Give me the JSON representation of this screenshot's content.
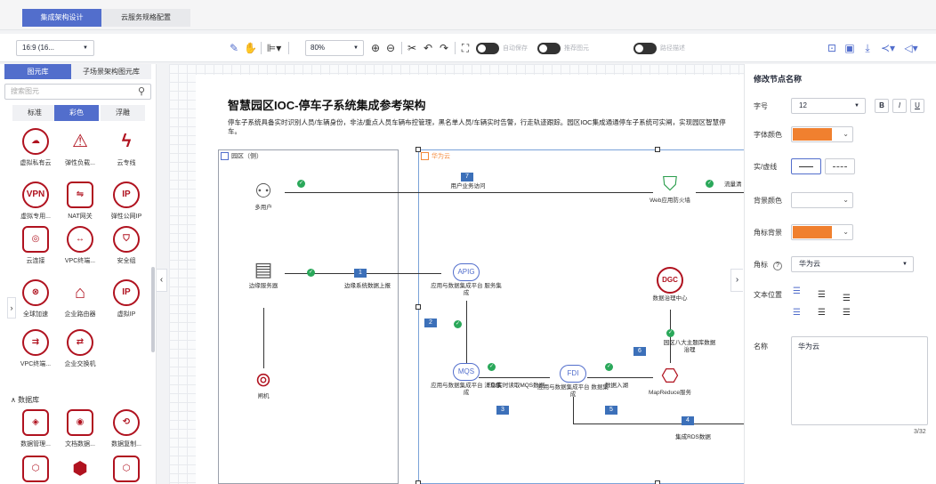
{
  "tabs": {
    "active": "集成架构设计",
    "inactive": "云服务规格配置"
  },
  "toolbar": {
    "ratio": "16:9 (16...",
    "zoom": "80%",
    "toggle_autosave": "自动保存",
    "toggle_recommend": "推荐图元",
    "toggle_path": "路径描述"
  },
  "left_panel": {
    "tab_library": "图元库",
    "tab_scene": "子场景架构图元库",
    "search_placeholder": "搜索图元",
    "sub_standard": "标准",
    "sub_color": "彩色",
    "sub_float": "浮雕",
    "section_database": "数据库",
    "icons": [
      {
        "label": "虚拟私有云",
        "glyph": "☁"
      },
      {
        "label": "弹性负载...",
        "glyph": "⚠"
      },
      {
        "label": "云专线",
        "glyph": "ϟ"
      },
      {
        "label": "虚拟专用...",
        "glyph": "VPN"
      },
      {
        "label": "NAT网关",
        "glyph": "⇋"
      },
      {
        "label": "弹性公网IP",
        "glyph": "IP"
      },
      {
        "label": "云连接",
        "glyph": "◎"
      },
      {
        "label": "VPC终端...",
        "glyph": "↔"
      },
      {
        "label": "安全组",
        "glyph": "⛉"
      },
      {
        "label": "全球加速",
        "glyph": "⊗"
      },
      {
        "label": "企业路由器",
        "glyph": "⌂"
      },
      {
        "label": "虚拟IP",
        "glyph": "IP"
      },
      {
        "label": "VPC终端...",
        "glyph": "⇉"
      },
      {
        "label": "企业交换机",
        "glyph": "⇄"
      },
      {
        "label": "数据管理...",
        "glyph": "◈"
      },
      {
        "label": "文档数据...",
        "glyph": "◉"
      },
      {
        "label": "数据复制...",
        "glyph": "⟲"
      },
      {
        "label": "",
        "glyph": "⬡"
      },
      {
        "label": "",
        "glyph": "⬢"
      },
      {
        "label": "",
        "glyph": "⬡"
      }
    ]
  },
  "diagram": {
    "title": "智慧园区IOC-停车子系统集成参考架构",
    "description": "停车子系统具备实时识别人员/车辆身份，非法/重点人员车辆布控管理，黑名单人员/车辆实时告警，行走轨迹跟踪。园区IOC集成通通停车子系统可实闸，实现园区智慧停车。",
    "zone_park": "园区（侧）",
    "zone_huawei": "华为云",
    "nodes": {
      "users": "多用户",
      "edge": "边缘服务器",
      "gate": "闸机",
      "apig": "应用与数据集成平台 服务集成",
      "waf": "Web应用防火墙",
      "dgc": "数据治理中心",
      "mqs": "应用与数据集成平台 消息集成",
      "fdi": "应用与数据集成平台 数据集成",
      "mrs": "MapReduce服务"
    },
    "icon_text": {
      "dgc": "DGC",
      "apig": "APIG",
      "mqs": "MQS",
      "fdi": "FDI"
    },
    "edges": {
      "e7": "用户业务访问",
      "e_flow": "流量清",
      "e1": "边缘系统数据上报",
      "e_theme": "园区八大主题库数据治理",
      "e_fdi": "FDI实时读取MQS数据",
      "e_lake": "数据入湖",
      "e4": "集成RDS数据"
    },
    "badges": {
      "b7": "7",
      "b1": "1",
      "b2": "2",
      "b6": "6",
      "b3": "3",
      "b5": "5",
      "b4": "4"
    }
  },
  "right_panel": {
    "title": "修改节点名称",
    "font_size_label": "字号",
    "font_size": "12",
    "bold": "B",
    "italic": "I",
    "underline": "U",
    "font_color_label": "字体颜色",
    "font_color": "#f0802f",
    "line_label": "实/虚线",
    "bg_label": "背景颜色",
    "badge_bg_label": "角标背景",
    "badge_bg": "#f0802f",
    "badge_label": "角标",
    "badge_help": "?",
    "badge_value": "华为云",
    "text_pos_label": "文本位置",
    "name_label": "名称",
    "name_value": "华为云",
    "counter": "3/32"
  }
}
